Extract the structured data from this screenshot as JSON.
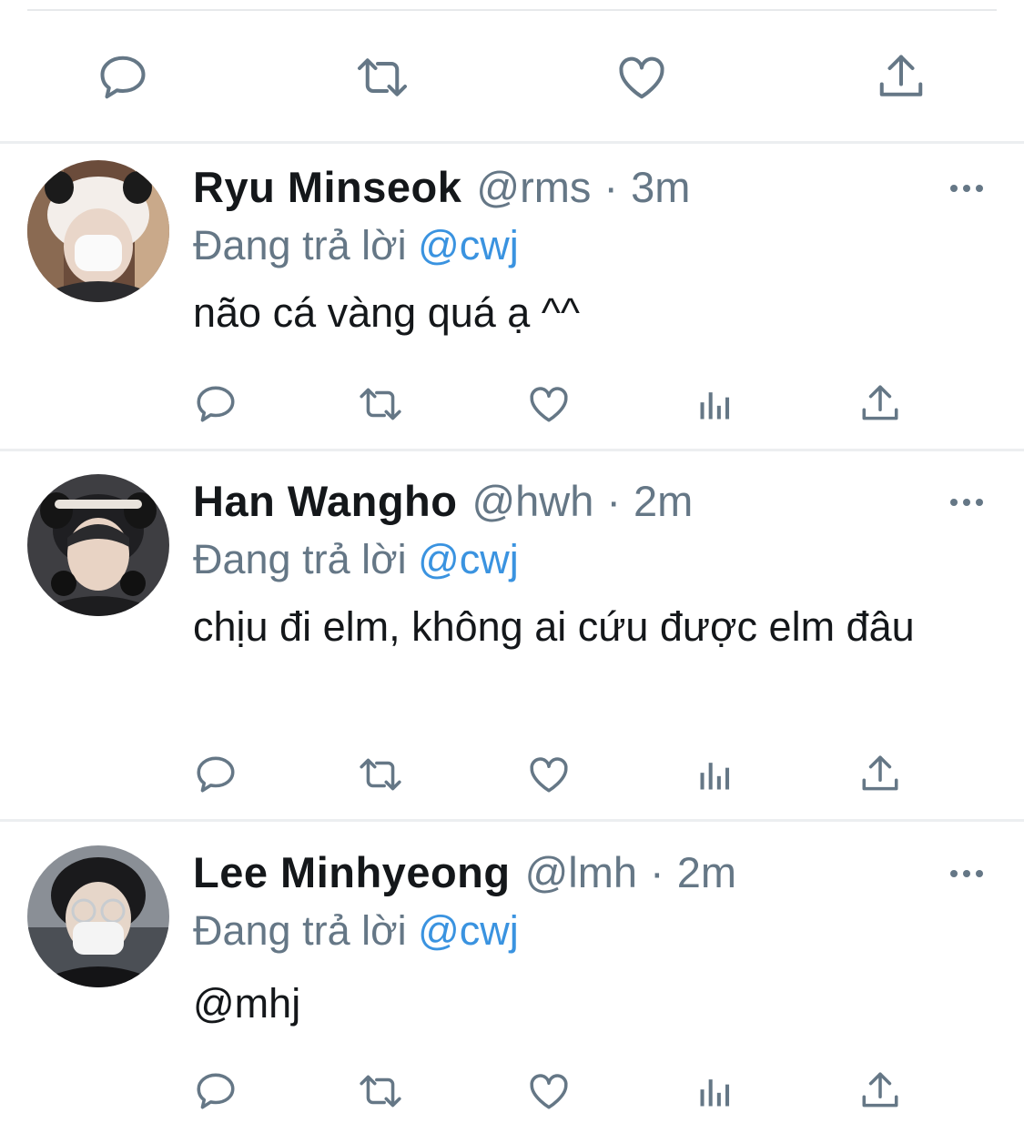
{
  "top_actions": {
    "reply_icon": "reply-icon",
    "retweet_icon": "retweet-icon",
    "like_icon": "heart-icon",
    "share_icon": "share-icon"
  },
  "tweets": [
    {
      "name": "Ryu Minseok",
      "handle": "@rms",
      "separator": "·",
      "time": "3m",
      "replying_prefix": "Đang trả lời",
      "replying_to": "@cwj",
      "text": "não cá vàng quá ạ ^^",
      "avatar_colors": {
        "bg": "#6b4c3b",
        "face": "#e9d6c9"
      }
    },
    {
      "name": "Han Wangho",
      "handle": "@hwh",
      "separator": "·",
      "time": "2m",
      "replying_prefix": "Đang trả lời",
      "replying_to": "@cwj",
      "text": "chịu đi elm, không ai cứu được elm đâu",
      "avatar_colors": {
        "bg": "#3e3e42",
        "face": "#e8d3c4"
      }
    },
    {
      "name": "Lee Minhyeong",
      "handle": "@lmh",
      "separator": "·",
      "time": "2m",
      "replying_prefix": "Đang trả lời",
      "replying_to": "@cwj",
      "text": "@mhj",
      "text_is_mention": true,
      "avatar_colors": {
        "bg": "#8a8f96",
        "face": "#e6d6c9"
      }
    }
  ],
  "colors": {
    "icon_gray": "#657786",
    "mention_blue": "#3a93e0",
    "name_black": "#14171a",
    "divider": "#eceef0"
  }
}
